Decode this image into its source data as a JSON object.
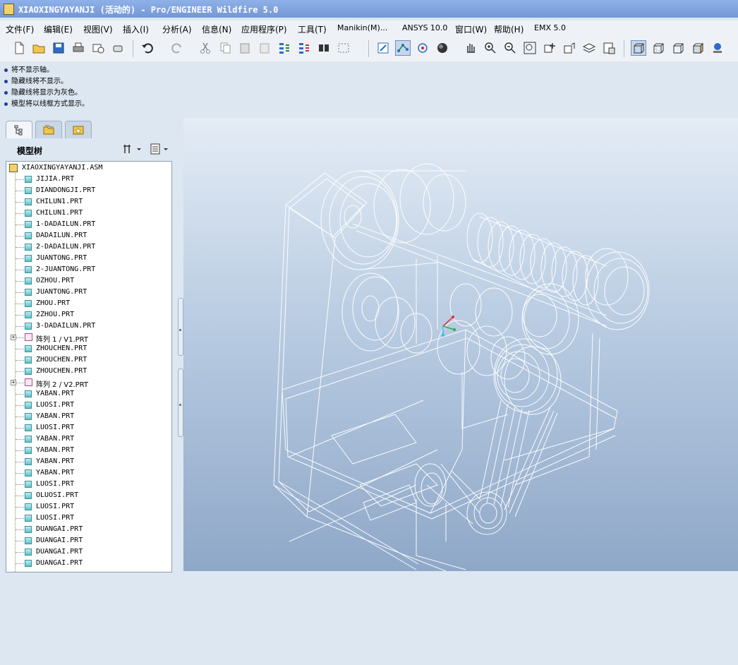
{
  "window": {
    "title": "XIAOXINGYAYANJI (活动的) - Pro/ENGINEER Wildfire 5.0"
  },
  "menu": [
    "文件(F)",
    "编辑(E)",
    "视图(V)",
    "插入(I)",
    "分析(A)",
    "信息(N)",
    "应用程序(P)",
    "工具(T)",
    "Manikin(M)...",
    "ANSYS 10.0",
    "窗口(W)",
    "帮助(H)",
    "EMX 5.0"
  ],
  "messages": [
    "将不显示轴。",
    "隐藏线将不显示。",
    "隐藏线将显示为灰色。",
    "模型将以线框方式显示。"
  ],
  "model_tree": {
    "title": "模型树",
    "root": "XIAOXINGYAYANJI.ASM",
    "items": [
      {
        "label": "JIJIA.PRT",
        "type": "part"
      },
      {
        "label": "DIANDONGJI.PRT",
        "type": "part"
      },
      {
        "label": "CHILUN1.PRT",
        "type": "part"
      },
      {
        "label": "CHILUN1.PRT",
        "type": "part"
      },
      {
        "label": "1-DADAILUN.PRT",
        "type": "part"
      },
      {
        "label": "DADAILUN.PRT",
        "type": "part"
      },
      {
        "label": "2-DADAILUN.PRT",
        "type": "part"
      },
      {
        "label": "JUANTONG.PRT",
        "type": "part"
      },
      {
        "label": "2-JUANTONG.PRT",
        "type": "part"
      },
      {
        "label": "OZHOU.PRT",
        "type": "part"
      },
      {
        "label": "JUANTONG.PRT",
        "type": "part"
      },
      {
        "label": "ZHOU.PRT",
        "type": "part"
      },
      {
        "label": "2ZHOU.PRT",
        "type": "part"
      },
      {
        "label": "3-DADAILUN.PRT",
        "type": "part"
      },
      {
        "label": "阵列 1 / V1.PRT",
        "type": "pattern"
      },
      {
        "label": "ZHOUCHEN.PRT",
        "type": "part"
      },
      {
        "label": "ZHOUCHEN.PRT",
        "type": "part"
      },
      {
        "label": "ZHOUCHEN.PRT",
        "type": "part"
      },
      {
        "label": "阵列 2 / V2.PRT",
        "type": "pattern"
      },
      {
        "label": "YABAN.PRT",
        "type": "part"
      },
      {
        "label": "LUOSI.PRT",
        "type": "part"
      },
      {
        "label": "YABAN.PRT",
        "type": "part"
      },
      {
        "label": "LUOSI.PRT",
        "type": "part"
      },
      {
        "label": "YABAN.PRT",
        "type": "part"
      },
      {
        "label": "YABAN.PRT",
        "type": "part"
      },
      {
        "label": "YABAN.PRT",
        "type": "part"
      },
      {
        "label": "YABAN.PRT",
        "type": "part"
      },
      {
        "label": "LUOSI.PRT",
        "type": "part"
      },
      {
        "label": "OLUOSI.PRT",
        "type": "part"
      },
      {
        "label": "LUOSI.PRT",
        "type": "part"
      },
      {
        "label": "LUOSI.PRT",
        "type": "part"
      },
      {
        "label": "DUANGAI.PRT",
        "type": "part"
      },
      {
        "label": "DUANGAI.PRT",
        "type": "part"
      },
      {
        "label": "DUANGAI.PRT",
        "type": "part"
      },
      {
        "label": "DUANGAI.PRT",
        "type": "part"
      }
    ]
  },
  "toolbar_icons": [
    "new-file-icon",
    "open-icon",
    "save-icon",
    "print-icon",
    "send-mail-icon",
    "mail-attach-icon",
    "undo-icon",
    "redo-icon",
    "cut-icon",
    "copy-icon",
    "paste-icon",
    "paste-special-icon",
    "regenerate-icon",
    "regenerate-manager-icon",
    "find-icon",
    "select-box-icon",
    "refit-icon",
    "datum-display-icon",
    "spin-center-icon",
    "shading-icon",
    "pan-icon",
    "zoom-in-icon",
    "zoom-out-icon",
    "zoom-window-icon",
    "orient-icon",
    "saved-views-icon",
    "layers-icon",
    "view-manager-icon",
    "wireframe-icon",
    "hidden-line-icon",
    "no-hidden-icon",
    "shaded-icon",
    "enhanced-realism-icon"
  ],
  "colors": {
    "titlebar": "#7f9fdc",
    "viewport_top": "#e4ecf5",
    "viewport_bottom": "#8fa8c8",
    "wireframe": "#ffffff"
  }
}
